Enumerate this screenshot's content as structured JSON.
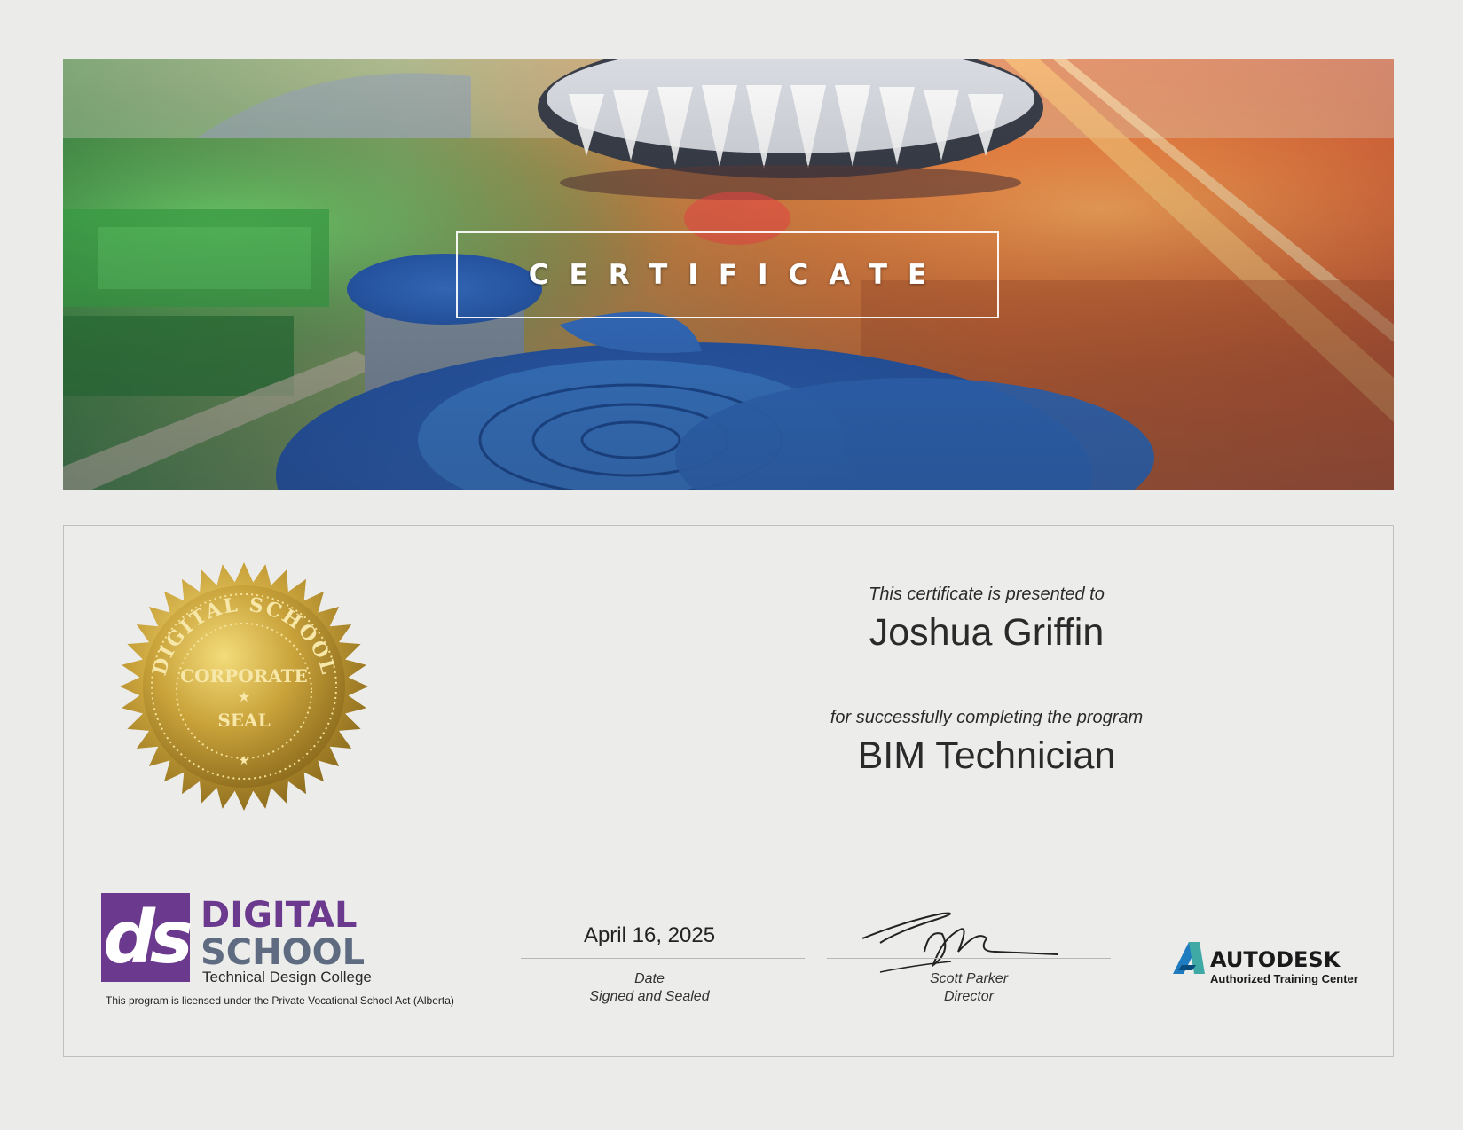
{
  "banner": {
    "title": "CERTIFICATE"
  },
  "seal": {
    "ring_text": "DIGITAL SCHOOL",
    "line1": "CORPORATE",
    "line2": "SEAL"
  },
  "recipient": {
    "presented_to": "This certificate is presented to",
    "name": "Joshua Griffin",
    "completion_text": "for successfully completing the program",
    "program": "BIM Technician"
  },
  "school_logo": {
    "letters": "ds",
    "line1": "DIGITAL",
    "line2": "SCHOOL",
    "line3": "Technical Design College",
    "license": "This program is licensed under the Private Vocational School Act (Alberta)"
  },
  "date_block": {
    "date": "April 16, 2025",
    "label1": "Date",
    "label2": "Signed and Sealed"
  },
  "signature_block": {
    "name": "Scott Parker",
    "title": "Director"
  },
  "autodesk": {
    "brand": "AUTODESK",
    "subtitle": "Authorized Training Center"
  },
  "colors": {
    "purple": "#6b3a8f",
    "slate": "#5e6b80",
    "gold": "#c9a23a",
    "autodesk_blue": "#1f7bbf"
  }
}
